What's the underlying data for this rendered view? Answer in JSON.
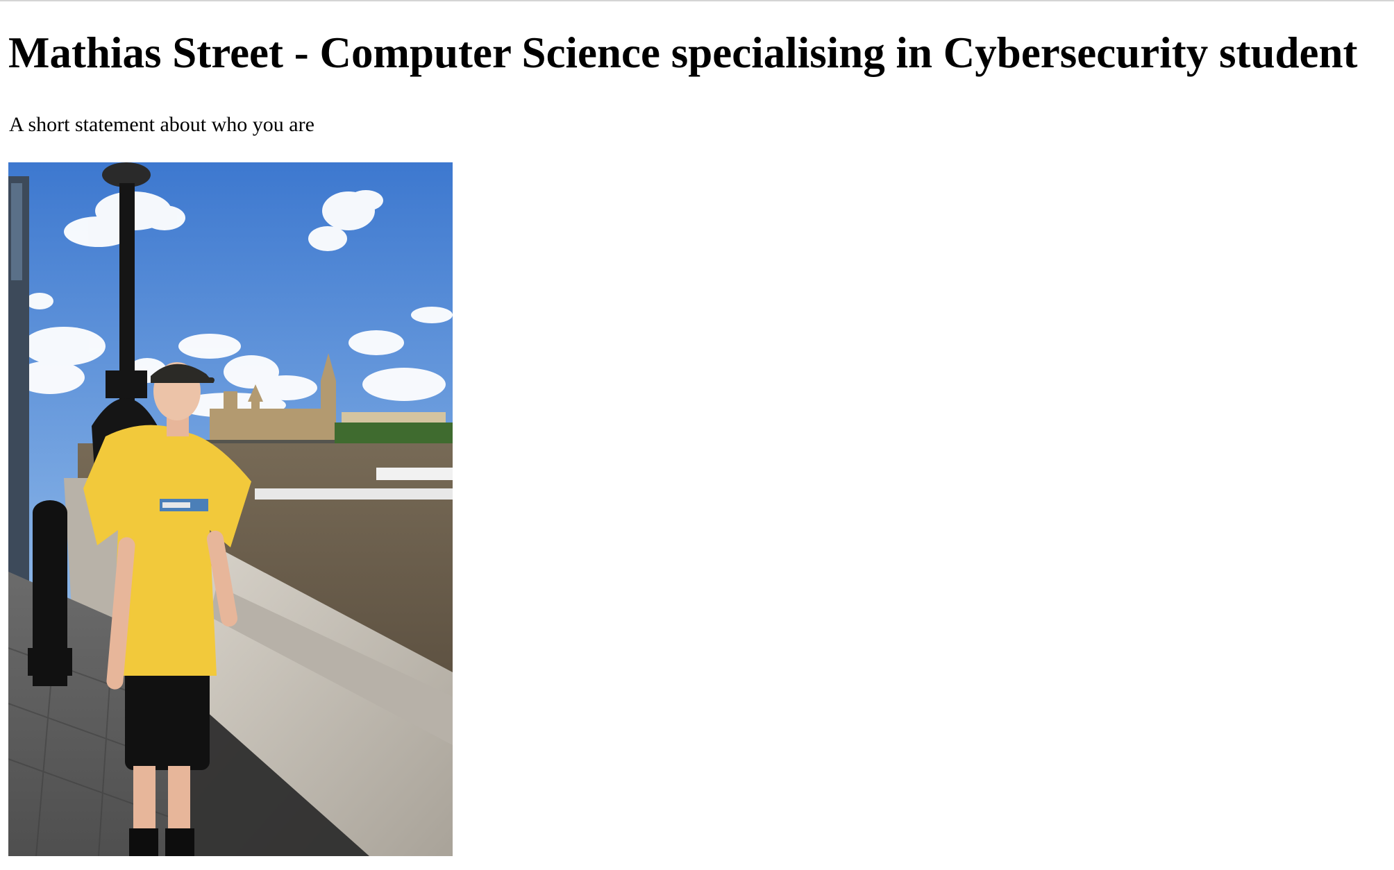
{
  "page": {
    "title": "Mathias Street - Computer Science specialising in Cybersecurity student",
    "intro": "A short statement about who you are"
  },
  "photo": {
    "colors": {
      "sky": "#4a86d4",
      "water": "#6b5e4b",
      "shirt": "#f2c93b",
      "stone": "#c9c4bb",
      "lamp": "#151515"
    }
  }
}
